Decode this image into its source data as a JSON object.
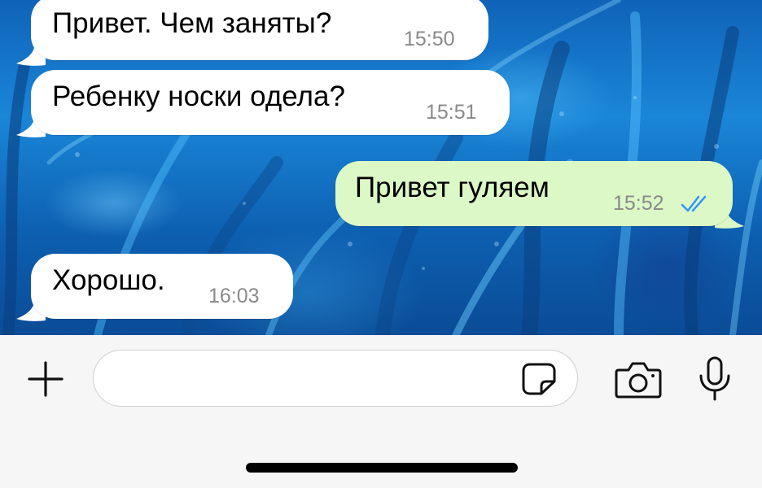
{
  "chat": {
    "messages": [
      {
        "direction": "incoming",
        "text": "Привет. Чем заняты?",
        "time": "15:50"
      },
      {
        "direction": "incoming",
        "text": "Ребенку носки одела?",
        "time": "15:51"
      },
      {
        "direction": "outgoing",
        "text": "Привет гуляем",
        "time": "15:52",
        "status_icon": "double-check-icon"
      },
      {
        "direction": "incoming",
        "text": "Хорошо.",
        "time": "16:03"
      }
    ]
  },
  "input_bar": {
    "message_value": "",
    "icons": [
      "plus-icon",
      "sticker-icon",
      "camera-icon",
      "microphone-icon"
    ]
  },
  "colors": {
    "incoming_bubble": "#ffffff",
    "outgoing_bubble": "#dcf8c6",
    "read_receipt": "#3497f9",
    "timestamp": "#8a8a8a"
  }
}
